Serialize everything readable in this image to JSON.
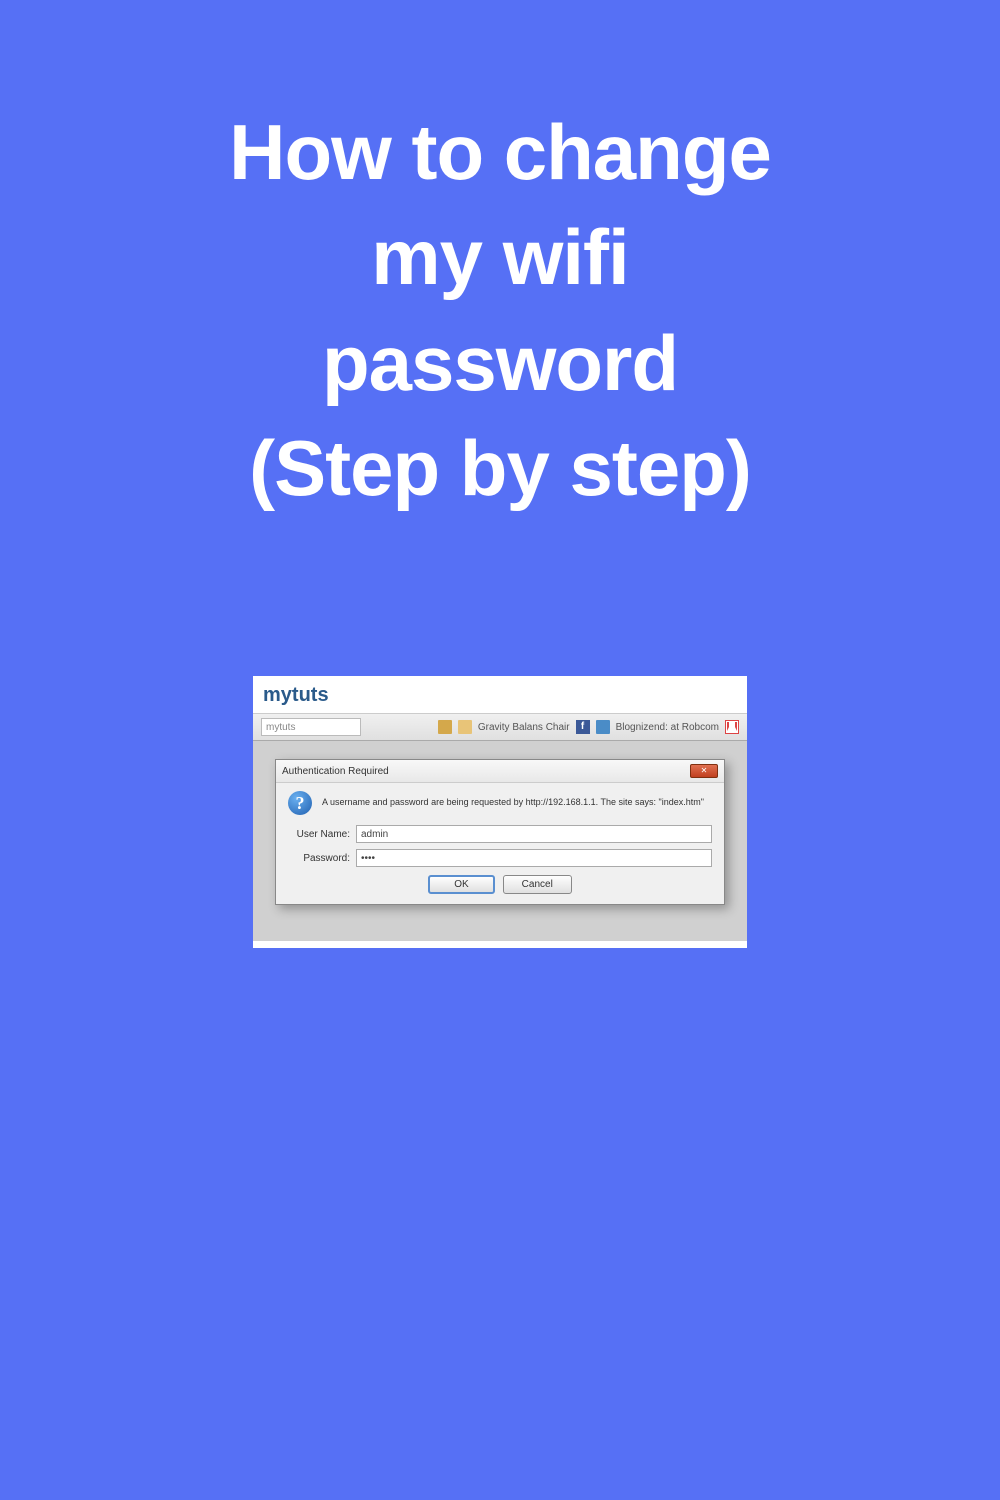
{
  "title_line1": "How to change",
  "title_line2": "my wifi",
  "title_line3": "password",
  "title_line4": "(Step by step)",
  "browser": {
    "title": "mytuts",
    "url_field": "mytuts",
    "bookmark1": "Gravity Balans Chair",
    "bookmark2": "Blognizend: at Robcom"
  },
  "dialog": {
    "title": "Authentication Required",
    "close_label": "✕",
    "info_icon": "?",
    "message": "A username and password are being requested by http://192.168.1.1. The site says: \"index.htm\"",
    "username_label": "User Name:",
    "username_value": "admin",
    "password_label": "Password:",
    "password_value": "••••",
    "ok_label": "OK",
    "cancel_label": "Cancel"
  }
}
